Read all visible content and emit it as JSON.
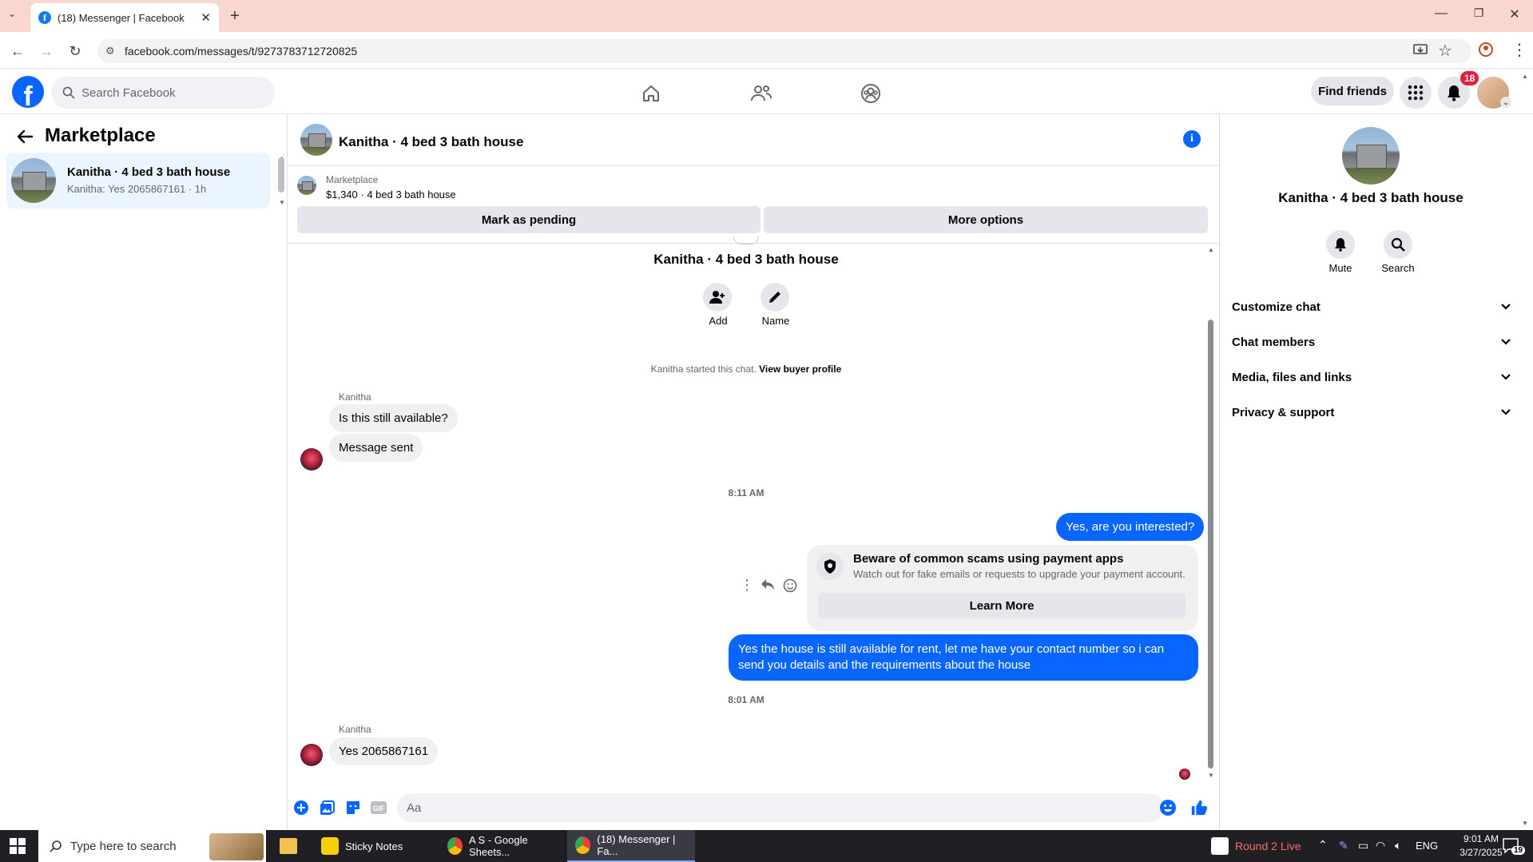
{
  "browser": {
    "tab_title": "(18) Messenger | Facebook",
    "url": "facebook.com/messages/t/9273783712720825"
  },
  "header": {
    "search_placeholder": "Search Facebook",
    "find_friends": "Find friends",
    "notification_count": "18"
  },
  "left": {
    "title": "Marketplace",
    "conversation": {
      "title": "Kanitha · 4 bed 3 bath house",
      "preview": "Kanitha: Yes 2065867161 · 1h"
    }
  },
  "chat": {
    "title": "Kanitha · 4 bed 3 bath house",
    "marketplace_label": "Marketplace",
    "listing": "$1,340 · 4 bed 3 bath house",
    "mark_pending": "Mark as pending",
    "more_options": "More options",
    "center_name": "Kanitha · 4 bed 3 bath house",
    "add_label": "Add",
    "name_label": "Name",
    "started_text": "Kanitha started this chat.",
    "view_buyer": "View buyer profile",
    "messages": {
      "sender1": "Kanitha",
      "in1": "Is this still available?",
      "in2": "Message sent",
      "ts1": "8:11 AM",
      "out1": "Yes, are you interested?",
      "scam_title": "Beware of common scams using payment apps",
      "scam_sub": "Watch out for fake emails or requests to upgrade your payment account.",
      "learn_more": "Learn More",
      "out2": "Yes the house is still available for rent, let me have your contact number so i can send you details and the requirements about the house",
      "ts2": "8:01 AM",
      "sender2": "Kanitha",
      "in3": "Yes 2065867161"
    },
    "composer_placeholder": "Aa"
  },
  "right": {
    "title": "Kanitha · 4 bed 3 bath house",
    "mute": "Mute",
    "search": "Search",
    "items": [
      "Customize chat",
      "Chat members",
      "Media, files and links",
      "Privacy & support"
    ]
  },
  "taskbar": {
    "search_placeholder": "Type here to search",
    "apps": [
      "Sticky Notes",
      "A S - Google Sheets...",
      "(18) Messenger | Fa..."
    ],
    "live": "Round 2 Live",
    "lang": "ENG",
    "time": "9:01 AM",
    "date": "3/27/2025",
    "notif_count": "19"
  },
  "colors": {
    "brand": "#0866ff",
    "bubble_out": "#0866ff",
    "bubble_in": "#f0f0f0"
  }
}
